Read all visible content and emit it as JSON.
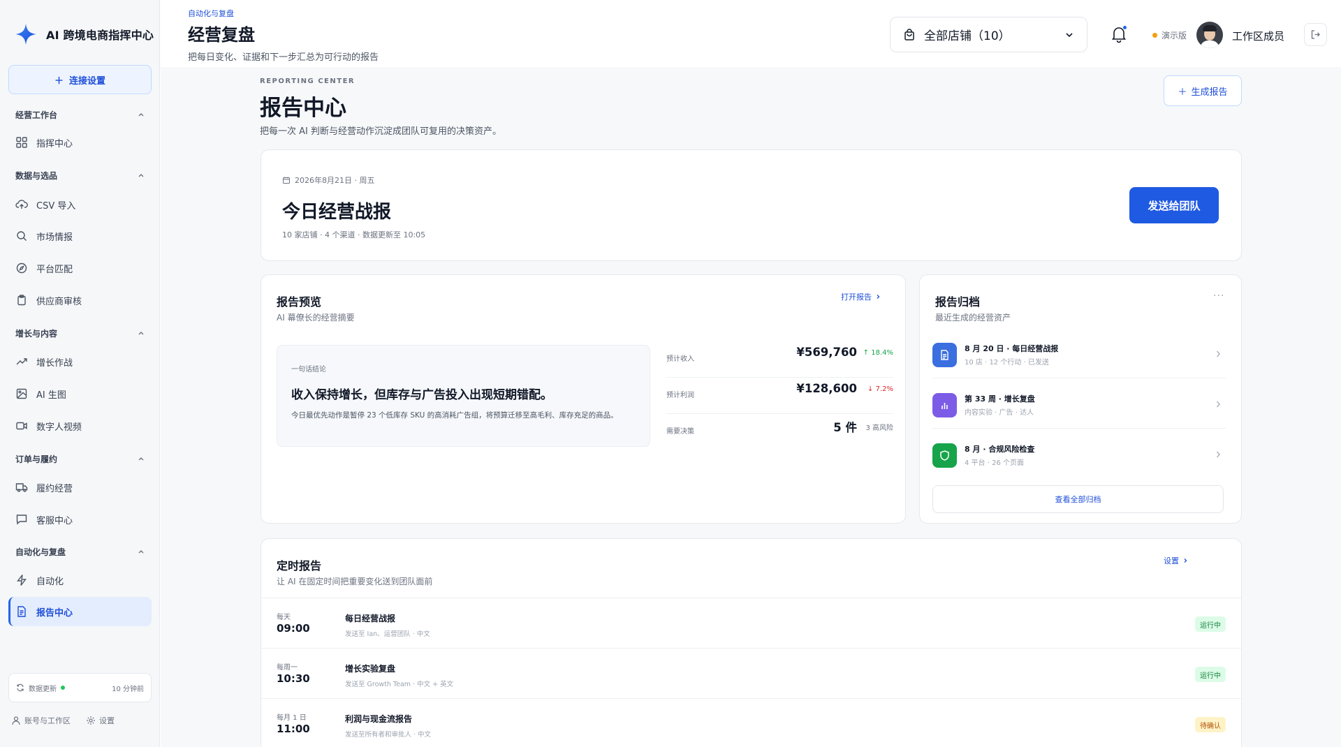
{
  "app": {
    "name": "AI 跨境电商指挥中心"
  },
  "sidebar": {
    "connect_label": "连接设置",
    "groups": [
      {
        "label": "经营工作台",
        "items": [
          {
            "label": "指挥中心",
            "icon": "grid-icon"
          }
        ]
      },
      {
        "label": "数据与选品",
        "items": [
          {
            "label": "CSV 导入",
            "icon": "upload-cloud-icon"
          },
          {
            "label": "市场情报",
            "icon": "search-icon"
          },
          {
            "label": "平台匹配",
            "icon": "compass-icon"
          },
          {
            "label": "供应商审核",
            "icon": "clipboard-icon"
          }
        ]
      },
      {
        "label": "增长与内容",
        "items": [
          {
            "label": "增长作战",
            "icon": "trend-up-icon"
          },
          {
            "label": "AI 生图",
            "icon": "image-icon"
          },
          {
            "label": "数字人视频",
            "icon": "video-icon"
          }
        ]
      },
      {
        "label": "订单与履约",
        "items": [
          {
            "label": "履约经营",
            "icon": "truck-icon"
          },
          {
            "label": "客服中心",
            "icon": "chat-icon"
          }
        ]
      },
      {
        "label": "自动化与复盘",
        "items": [
          {
            "label": "自动化",
            "icon": "bolt-icon"
          },
          {
            "label": "报告中心",
            "icon": "document-icon",
            "active": true
          }
        ]
      }
    ],
    "sync": {
      "label": "数据更新",
      "time": "10 分钟前"
    },
    "footer": {
      "account": "账号与工作区",
      "settings": "设置"
    }
  },
  "header": {
    "breadcrumb": "自动化与复盘",
    "title": "经营复盘",
    "subtitle": "把每日变化、证据和下一步汇总为可行动的报告",
    "store_select": "全部店铺（10）",
    "demo_label": "演示版",
    "user_name": "工作区成员"
  },
  "reporting": {
    "eyebrow": "REPORTING CENTER",
    "title": "报告中心",
    "subtitle": "把每一次 AI 判断与经营动作沉淀成团队可复用的决策资产。",
    "generate_label": "生成报告"
  },
  "daily": {
    "date": "2026年8月21日 · 周五",
    "title": "今日经营战报",
    "meta": "10 家店铺 · 4 个渠道 · 数据更新至 10:05",
    "send_label": "发送给团队"
  },
  "preview": {
    "title": "报告预览",
    "subtitle": "AI 幕僚长的经营摘要",
    "open_label": "打开报告",
    "conclusion_label": "一句话结论",
    "conclusion_head": "收入保持增长，但库存与广告投入出现短期错配。",
    "conclusion_body": "今日最优先动作是暂停 23 个低库存 SKU 的高消耗广告组，将预算迁移至高毛利、库存充足的商品。",
    "metrics": [
      {
        "label": "预计收入",
        "value": "¥569,760",
        "change": "↑ 18.4%",
        "dir": "up"
      },
      {
        "label": "预计利润",
        "value": "¥128,600",
        "change": "↓ 7.2%",
        "dir": "down"
      },
      {
        "label": "需要决策",
        "value": "5 件",
        "change": "3 高风险",
        "dir": "neutral"
      }
    ]
  },
  "archive": {
    "title": "报告归档",
    "subtitle": "最近生成的经营资产",
    "items": [
      {
        "title": "8 月 20 日 · 每日经营战报",
        "meta": "10 店 · 12 个行动 · 已发送",
        "icon": "document-icon",
        "color": "#3b6fe0"
      },
      {
        "title": "第 33 周 · 增长复盘",
        "meta": "内容实验 · 广告 · 达人",
        "icon": "bar-chart-icon",
        "color": "#7c5ce6"
      },
      {
        "title": "8 月 · 合规风险检查",
        "meta": "4 平台 · 26 个页面",
        "icon": "shield-icon",
        "color": "#16a34a"
      }
    ],
    "view_all_label": "查看全部归档"
  },
  "scheduled": {
    "title": "定时报告",
    "subtitle": "让 AI 在固定时间把重要变化送到团队面前",
    "settings_label": "设置",
    "rows": [
      {
        "when": "每天",
        "time": "09:00",
        "name": "每日经营战报",
        "meta": "发送至 Ian、运营团队 · 中文",
        "status": "运行中",
        "state": "run"
      },
      {
        "when": "每周一",
        "time": "10:30",
        "name": "增长实验复盘",
        "meta": "发送至 Growth Team · 中文 + 英文",
        "status": "运行中",
        "state": "run"
      },
      {
        "when": "每月 1 日",
        "time": "11:00",
        "name": "利润与现金流报告",
        "meta": "发送至所有者和审批人 · 中文",
        "status": "待确认",
        "state": "wait"
      }
    ]
  }
}
